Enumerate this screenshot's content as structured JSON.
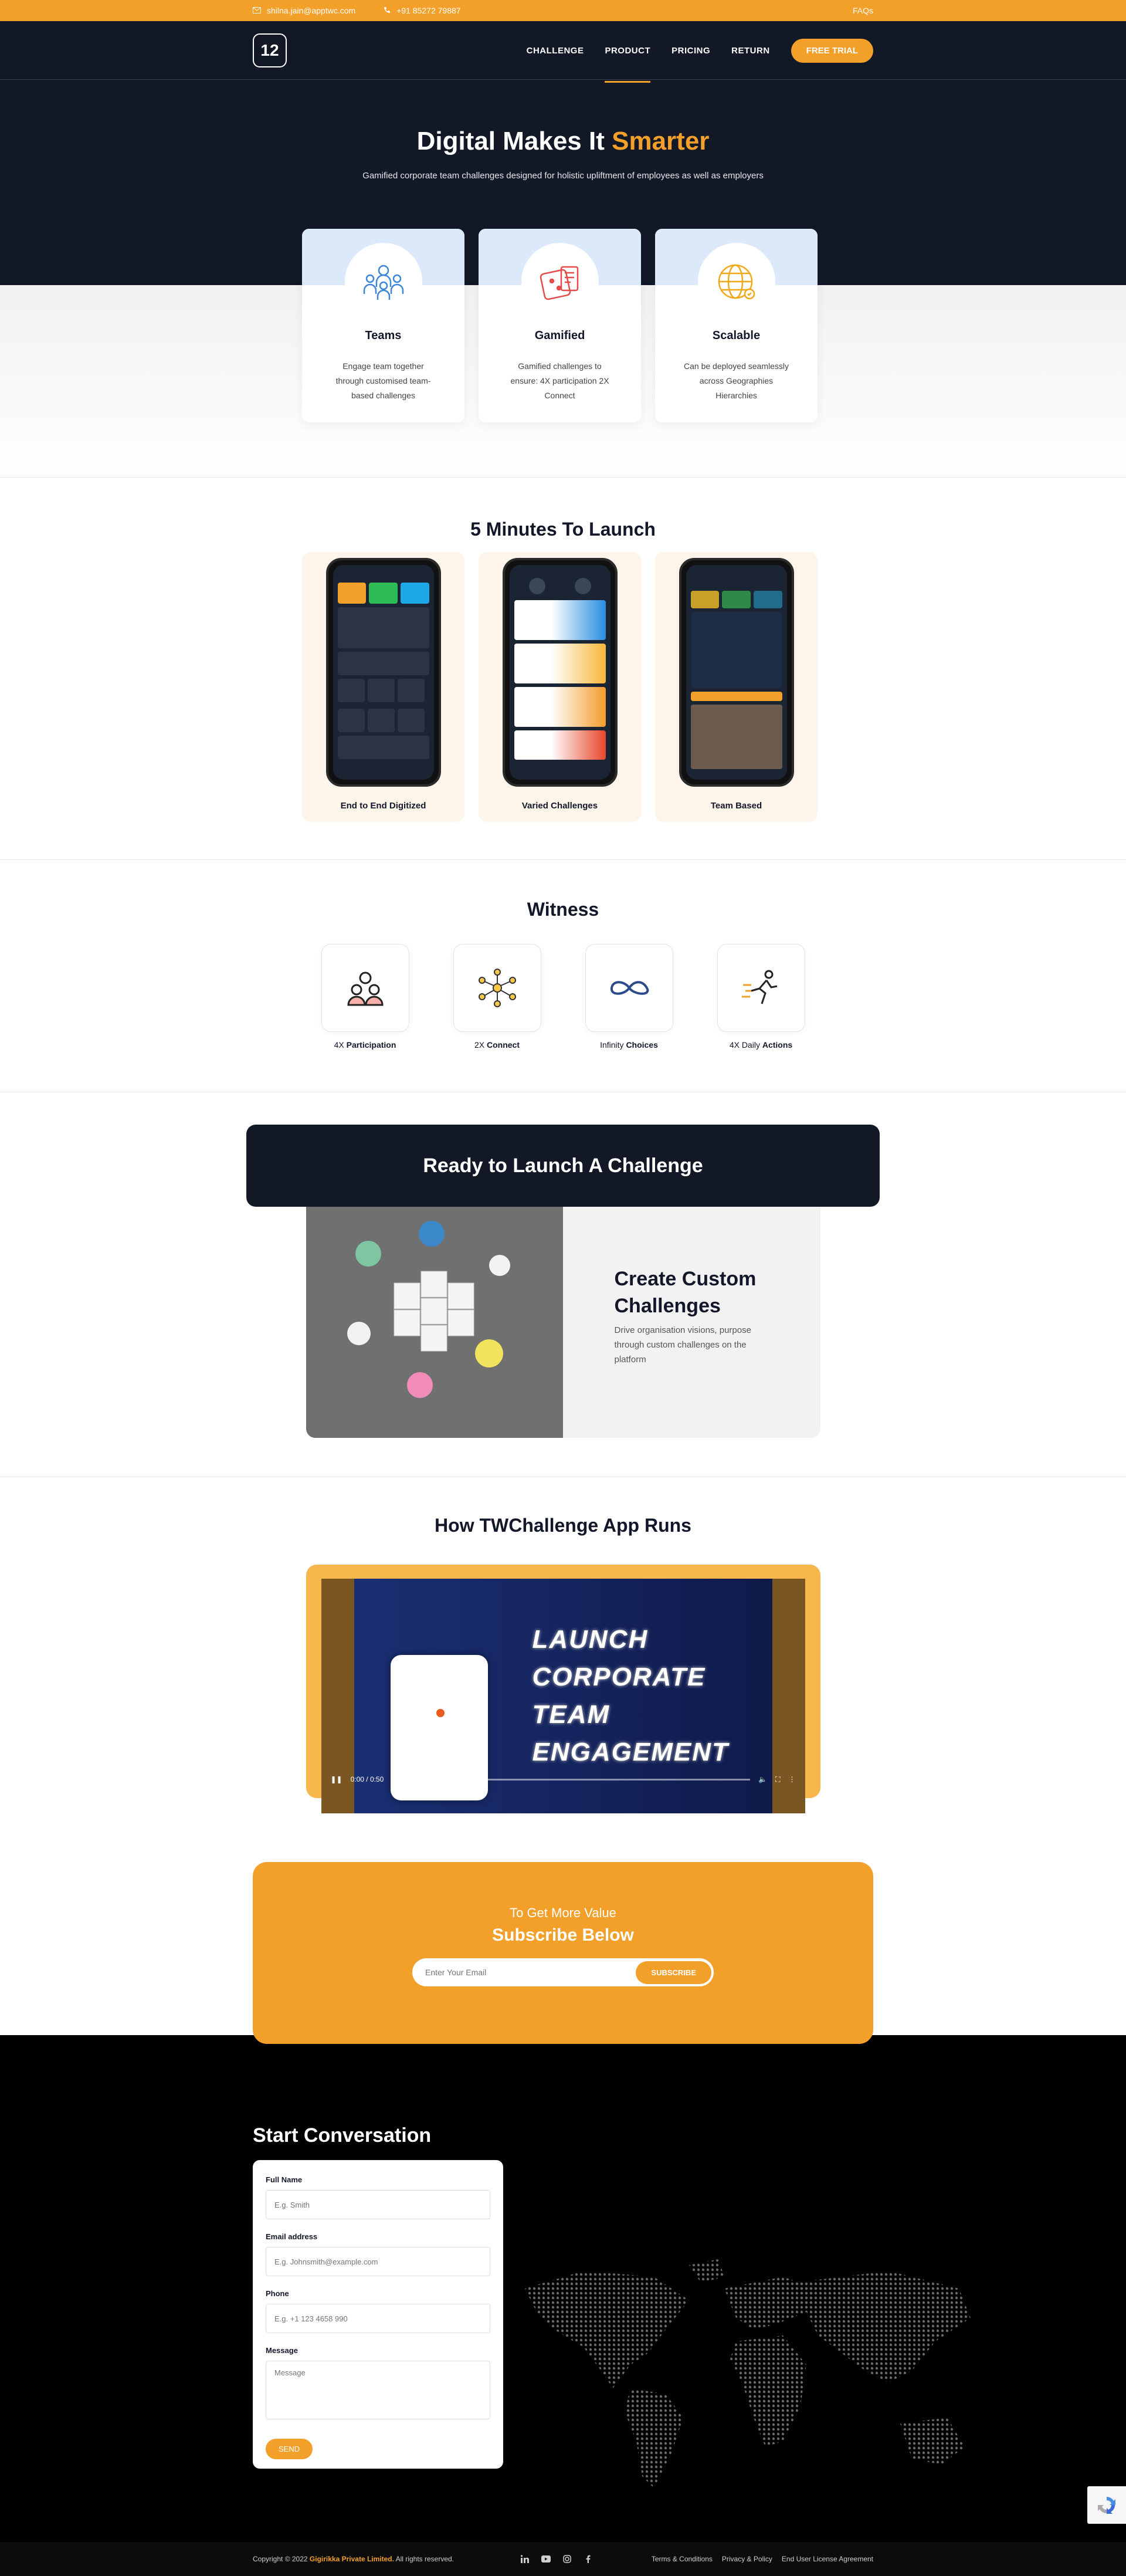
{
  "topbar": {
    "email": "shilna.jain@apptwc.com",
    "phone": "+91 85272 79887",
    "faq": "FAQs"
  },
  "header": {
    "logo_text": "12",
    "nav": [
      {
        "label": "CHALLENGE"
      },
      {
        "label": "PRODUCT"
      },
      {
        "label": "PRICING"
      },
      {
        "label": "RETURN"
      }
    ],
    "cta": "FREE TRIAL"
  },
  "hero": {
    "title": "Digital Makes It",
    "title_accent": "Smarter",
    "subtitle": "Gamified corporate team challenges designed for holistic upliftment of employees as well as employers"
  },
  "features": [
    {
      "icon": "teams-icon",
      "title": "Teams",
      "text": "Engage team together through customised team-based challenges"
    },
    {
      "icon": "gamified-icon",
      "title": "Gamified",
      "text": "Gamified challenges to ensure: 4X participation 2X Connect"
    },
    {
      "icon": "globe-icon",
      "title": "Scalable",
      "text": "Can be deployed seamlessly across Geographies Hierarchies"
    }
  ],
  "launch": {
    "title": "5 Minutes To Launch",
    "cards": [
      {
        "caption": "End to End Digitized"
      },
      {
        "caption": "Varied Challenges"
      },
      {
        "caption": "Team Based"
      }
    ]
  },
  "witness": {
    "title": "Witness",
    "items": [
      {
        "prefix": "4X",
        "bold": "Participation",
        "icon": "people-icon"
      },
      {
        "prefix": "2X",
        "bold": "Connect",
        "icon": "network-icon"
      },
      {
        "prefix": "Infinity",
        "bold": "Choices",
        "icon": "infinity-icon"
      },
      {
        "prefix": "4X Daily",
        "bold": "Actions",
        "icon": "runner-icon"
      }
    ]
  },
  "ready": {
    "title": "Ready to Launch A Challenge",
    "custom_title": "Create Custom Challenges",
    "custom_text": "Drive organisation visions, purpose through custom challenges on the platform"
  },
  "app_runs": {
    "title": "How TWChallenge App Runs",
    "video_lines": [
      "LAUNCH",
      "CORPORATE",
      "TEAM",
      "ENGAGEMENT"
    ],
    "video_time": "0:00 / 0:50"
  },
  "subscribe": {
    "small": "To Get More Value",
    "large": "Subscribe Below",
    "placeholder": "Enter Your Email",
    "button": "SUBSCRIBE"
  },
  "contact": {
    "title": "Start Conversation",
    "fields": {
      "name_label": "Full Name",
      "name_placeholder": "E.g. Smith",
      "email_label": "Email address",
      "email_placeholder": "E.g. Johnsmith@example.com",
      "phone_label": "Phone",
      "phone_placeholder": "E.g. +1 123 4658 990",
      "message_label": "Message",
      "message_placeholder": "Message"
    },
    "send": "SEND"
  },
  "footer": {
    "copyright_prefix": "Copyright © 2022",
    "company": "Gigirikka Private Limited.",
    "rights": "All rights reserved.",
    "social": [
      "linkedin-icon",
      "youtube-icon",
      "instagram-icon",
      "facebook-icon"
    ],
    "links": [
      "Terms & Conditions",
      "Privacy & Policy",
      "End User License Agreement"
    ]
  },
  "colors": {
    "accent": "#f3a02b",
    "dark": "#131827"
  }
}
